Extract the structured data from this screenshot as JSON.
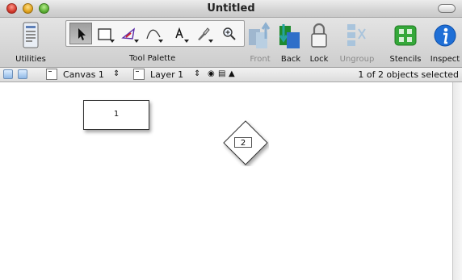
{
  "window": {
    "title": "Untitled"
  },
  "toolbar": {
    "utilities_label": "Utilities",
    "tool_palette_label": "Tool Palette",
    "front_label": "Front",
    "back_label": "Back",
    "lock_label": "Lock",
    "ungroup_label": "Ungroup",
    "stencils_label": "Stencils",
    "inspect_label": "Inspect",
    "tools": [
      "selection-arrow-icon",
      "rectangle-icon",
      "pen-icon",
      "curve-icon",
      "text-icon",
      "brush-icon",
      "magnifier-icon"
    ]
  },
  "statusbar": {
    "canvas_label": "Canvas 1",
    "layer_label": "Layer 1",
    "selection_status": "1 of 2 objects selected"
  },
  "canvas": {
    "shape1_text": "1",
    "shape2_text": "2"
  },
  "colors": {
    "inspect_blue": "#1f6fd6",
    "stencils_green": "#35a83a",
    "selection_gray": "#a9a9a9"
  }
}
